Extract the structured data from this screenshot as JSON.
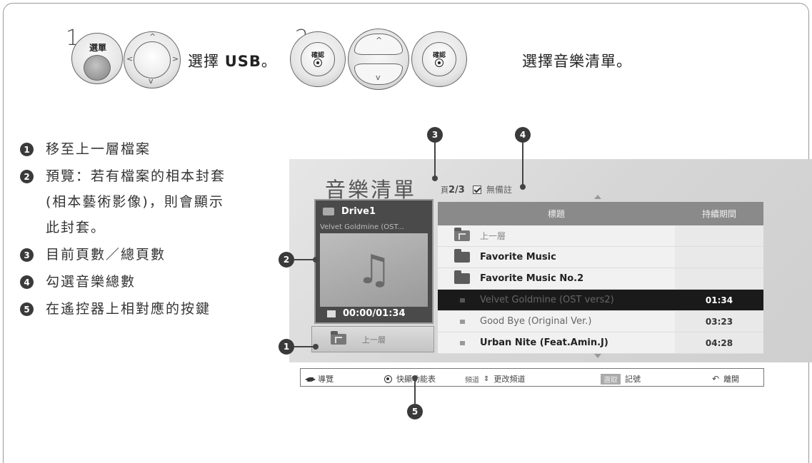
{
  "step1": {
    "number": "1",
    "button_label": "選單",
    "instruction_prefix": "選擇 ",
    "instruction_bold": "USB",
    "instruction_suffix": "。"
  },
  "step2": {
    "number": "2",
    "ok_label": "確認",
    "instruction": "選擇音樂清單。"
  },
  "legend": [
    {
      "num": "1",
      "text": "移至上一層檔案"
    },
    {
      "num": "2",
      "text": "預覽：若有檔案的相本封套"
    },
    {
      "num": "",
      "text": "(相本藝術影像)，則會顯示"
    },
    {
      "num": "",
      "text": "此封套。"
    },
    {
      "num": "3",
      "text": "目前頁數／總頁數"
    },
    {
      "num": "4",
      "text": "勾選音樂總數"
    },
    {
      "num": "5",
      "text": "在遙控器上相對應的按鍵"
    }
  ],
  "callouts": [
    "1",
    "2",
    "3",
    "4",
    "5"
  ],
  "screen": {
    "title": "音樂清單",
    "page_prefix": "頁",
    "page_value": "2/3",
    "mark_label": "無備註",
    "preview": {
      "drive": "Drive1",
      "subtitle": "Velvet Goldmine (OST...",
      "time": "00:00/01:34"
    },
    "up_button": "上一層",
    "columns": {
      "title": "標題",
      "duration": "持續期間"
    },
    "rows": [
      {
        "type": "up",
        "name": "上一層",
        "duration": ""
      },
      {
        "type": "folder",
        "name": "Favorite Music",
        "duration": ""
      },
      {
        "type": "folder",
        "name": "Favorite Music No.2",
        "duration": ""
      },
      {
        "type": "track",
        "name": "Velvet Goldmine (OST vers2)",
        "duration": "01:34",
        "selected": true
      },
      {
        "type": "track",
        "name": "Good Bye (Original Ver.)",
        "duration": "03:23"
      },
      {
        "type": "track",
        "name": "Urban Nite (Feat.Amin.J)",
        "duration": "04:28"
      }
    ]
  },
  "help_bar": {
    "navigate": "導覽",
    "quick_menu": "快顯功能表",
    "channel_key": "頻道",
    "change_channel": "更改頻道",
    "mark_key": "選取",
    "mark": "記號",
    "exit": "離開"
  }
}
